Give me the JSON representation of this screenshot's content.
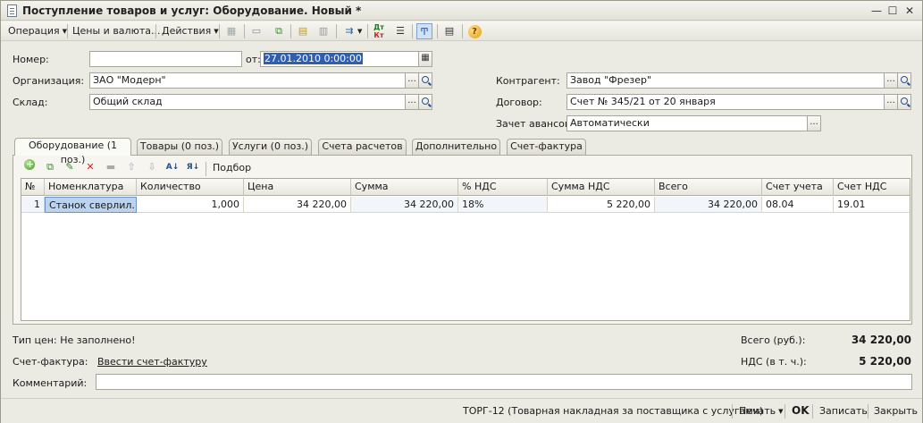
{
  "window": {
    "title": "Поступление товаров и услуг: Оборудование. Новый *",
    "minimize": "—",
    "maximize": "☐",
    "close": "✕"
  },
  "toolbar": {
    "operation": "Операция",
    "prices": "Цены и валюта...",
    "actions": "Действия",
    "help": "?"
  },
  "form": {
    "number_label": "Номер:",
    "number_value": "",
    "date_label": "от:",
    "date_value": "27.01.2010  0:00:00",
    "org_label": "Организация:",
    "org_value": "ЗАО \"Модерн\"",
    "warehouse_label": "Склад:",
    "warehouse_value": "Общий склад",
    "contractor_label": "Контрагент:",
    "contractor_value": "Завод \"Фрезер\"",
    "contract_label": "Договор:",
    "contract_value": "Счет № 345/21 от 20 января",
    "advance_label": "Зачет авансов:",
    "advance_value": "Автоматически",
    "ellipsis": "..."
  },
  "tabs": [
    {
      "label": "Оборудование (1 поз.)"
    },
    {
      "label": "Товары (0 поз.)"
    },
    {
      "label": "Услуги (0 поз.)"
    },
    {
      "label": "Счета расчетов"
    },
    {
      "label": "Дополнительно"
    },
    {
      "label": "Счет-фактура"
    }
  ],
  "table_toolbar": {
    "pick": "Подбор"
  },
  "table": {
    "columns": [
      "№",
      "Номенклатура",
      "Количество",
      "Цена",
      "Сумма",
      "% НДС",
      "Сумма НДС",
      "Всего",
      "Счет учета",
      "Счет НДС"
    ],
    "rows": [
      {
        "n": "1",
        "item": "Станок сверлил...",
        "qty": "1,000",
        "price": "34 220,00",
        "sum": "34 220,00",
        "vat_rate": "18%",
        "vat_sum": "5 220,00",
        "total": "34 220,00",
        "account": "08.04",
        "vat_account": "19.01"
      }
    ]
  },
  "footer": {
    "price_type": "Тип цен: Не заполнено!",
    "total_label": "Всего (руб.):",
    "total_value": "34 220,00",
    "invoice_label": "Счет-фактура:",
    "invoice_link": "Ввести счет-фактуру",
    "vat_label": "НДС (в т. ч.):",
    "vat_value": "5 220,00",
    "comment_label": "Комментарий:",
    "comment_value": ""
  },
  "bottom": {
    "torg": "ТОРГ-12 (Товарная накладная за поставщика с услугами)",
    "print": "Печать",
    "ok": "OK",
    "save": "Записать",
    "close": "Закрыть"
  }
}
